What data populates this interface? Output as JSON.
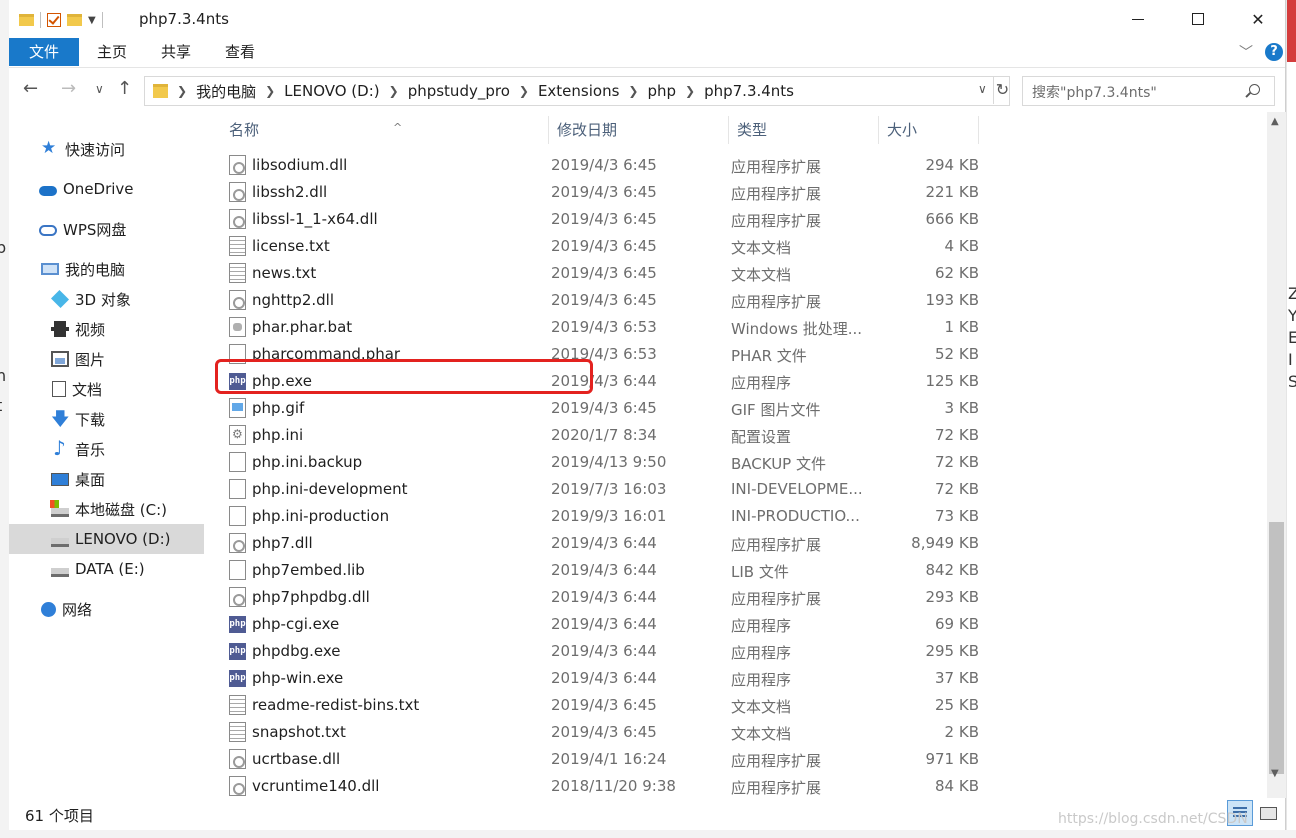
{
  "window": {
    "title": "php7.3.4nts"
  },
  "ribbon": {
    "tabs": [
      "文件",
      "主页",
      "共享",
      "查看"
    ],
    "help": "?"
  },
  "address": {
    "crumbs": [
      "我的电脑",
      "LENOVO (D:)",
      "phpstudy_pro",
      "Extensions",
      "php",
      "php7.3.4nts"
    ],
    "search_placeholder": "搜索\"php7.3.4nts\""
  },
  "sidebar": {
    "items": [
      {
        "label": "快速访问",
        "icon": "star-icon"
      },
      {
        "label": "OneDrive",
        "icon": "cloud-icon"
      },
      {
        "label": "WPS网盘",
        "icon": "wps-cloud-icon"
      },
      {
        "label": "我的电脑",
        "icon": "computer-icon"
      },
      {
        "label": "3D 对象",
        "icon": "3d-objects-icon"
      },
      {
        "label": "视频",
        "icon": "video-icon"
      },
      {
        "label": "图片",
        "icon": "pictures-icon"
      },
      {
        "label": "文档",
        "icon": "documents-icon"
      },
      {
        "label": "下载",
        "icon": "download-icon"
      },
      {
        "label": "音乐",
        "icon": "music-icon"
      },
      {
        "label": "桌面",
        "icon": "desktop-icon"
      },
      {
        "label": "本地磁盘 (C:)",
        "icon": "system-drive-icon"
      },
      {
        "label": "LENOVO (D:)",
        "icon": "drive-icon",
        "selected": true
      },
      {
        "label": "DATA (E:)",
        "icon": "drive-icon"
      },
      {
        "label": "网络",
        "icon": "network-icon"
      }
    ]
  },
  "columns": {
    "name": "名称",
    "date": "修改日期",
    "type": "类型",
    "size": "大小"
  },
  "files": [
    {
      "name": "libsodium.dll",
      "date": "2019/4/3 6:45",
      "type": "应用程序扩展",
      "size": "294 KB",
      "icon": "dll-icon"
    },
    {
      "name": "libssh2.dll",
      "date": "2019/4/3 6:45",
      "type": "应用程序扩展",
      "size": "221 KB",
      "icon": "dll-icon"
    },
    {
      "name": "libssl-1_1-x64.dll",
      "date": "2019/4/3 6:45",
      "type": "应用程序扩展",
      "size": "666 KB",
      "icon": "dll-icon"
    },
    {
      "name": "license.txt",
      "date": "2019/4/3 6:45",
      "type": "文本文档",
      "size": "4 KB",
      "icon": "text-file-icon"
    },
    {
      "name": "news.txt",
      "date": "2019/4/3 6:45",
      "type": "文本文档",
      "size": "62 KB",
      "icon": "text-file-icon"
    },
    {
      "name": "nghttp2.dll",
      "date": "2019/4/3 6:45",
      "type": "应用程序扩展",
      "size": "193 KB",
      "icon": "dll-icon"
    },
    {
      "name": "phar.phar.bat",
      "date": "2019/4/3 6:53",
      "type": "Windows 批处理...",
      "size": "1 KB",
      "icon": "batch-file-icon"
    },
    {
      "name": "pharcommand.phar",
      "date": "2019/4/3 6:53",
      "type": "PHAR 文件",
      "size": "52 KB",
      "icon": "file-icon"
    },
    {
      "name": "php.exe",
      "date": "2019/4/3 6:44",
      "type": "应用程序",
      "size": "125 KB",
      "icon": "php-exe-icon"
    },
    {
      "name": "php.gif",
      "date": "2019/4/3 6:45",
      "type": "GIF 图片文件",
      "size": "3 KB",
      "icon": "image-file-icon"
    },
    {
      "name": "php.ini",
      "date": "2020/1/7 8:34",
      "type": "配置设置",
      "size": "72 KB",
      "icon": "ini-file-icon"
    },
    {
      "name": "php.ini.backup",
      "date": "2019/4/13 9:50",
      "type": "BACKUP 文件",
      "size": "72 KB",
      "icon": "file-icon"
    },
    {
      "name": "php.ini-development",
      "date": "2019/7/3 16:03",
      "type": "INI-DEVELOPME...",
      "size": "72 KB",
      "icon": "file-icon"
    },
    {
      "name": "php.ini-production",
      "date": "2019/9/3 16:01",
      "type": "INI-PRODUCTIO...",
      "size": "73 KB",
      "icon": "file-icon"
    },
    {
      "name": "php7.dll",
      "date": "2019/4/3 6:44",
      "type": "应用程序扩展",
      "size": "8,949 KB",
      "icon": "dll-icon"
    },
    {
      "name": "php7embed.lib",
      "date": "2019/4/3 6:44",
      "type": "LIB 文件",
      "size": "842 KB",
      "icon": "file-icon"
    },
    {
      "name": "php7phpdbg.dll",
      "date": "2019/4/3 6:44",
      "type": "应用程序扩展",
      "size": "293 KB",
      "icon": "dll-icon"
    },
    {
      "name": "php-cgi.exe",
      "date": "2019/4/3 6:44",
      "type": "应用程序",
      "size": "69 KB",
      "icon": "php-exe-icon"
    },
    {
      "name": "phpdbg.exe",
      "date": "2019/4/3 6:44",
      "type": "应用程序",
      "size": "295 KB",
      "icon": "php-exe-icon"
    },
    {
      "name": "php-win.exe",
      "date": "2019/4/3 6:44",
      "type": "应用程序",
      "size": "37 KB",
      "icon": "php-exe-icon"
    },
    {
      "name": "readme-redist-bins.txt",
      "date": "2019/4/3 6:45",
      "type": "文本文档",
      "size": "25 KB",
      "icon": "text-file-icon"
    },
    {
      "name": "snapshot.txt",
      "date": "2019/4/3 6:45",
      "type": "文本文档",
      "size": "2 KB",
      "icon": "text-file-icon"
    },
    {
      "name": "ucrtbase.dll",
      "date": "2019/4/1 16:24",
      "type": "应用程序扩展",
      "size": "971 KB",
      "icon": "dll-icon"
    },
    {
      "name": "vcruntime140.dll",
      "date": "2018/11/20 9:38",
      "type": "应用程序扩展",
      "size": "84 KB",
      "icon": "dll-icon"
    }
  ],
  "status": {
    "count": "61 个项目"
  },
  "php_icon_text": "php",
  "watermark": "https://blog.csdn.net/CSDN",
  "colors": {
    "accent": "#1979ca",
    "highlight": "#e3221f",
    "selected": "#d9d9d9"
  }
}
